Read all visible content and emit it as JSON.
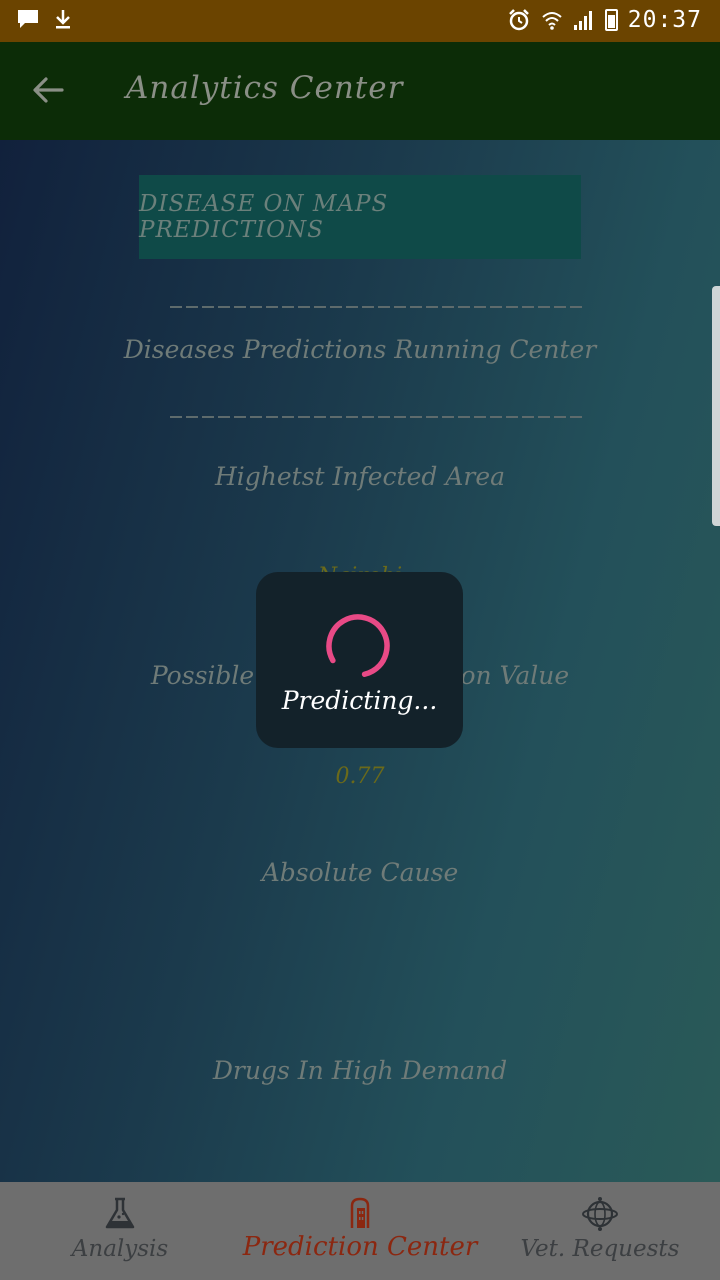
{
  "status_bar": {
    "time": "20:37",
    "icons": [
      "message-icon",
      "download-icon",
      "alarm-icon",
      "wifi-icon",
      "signal-icon",
      "battery-icon"
    ]
  },
  "app_bar": {
    "title": "Analytics Center",
    "back_icon": "arrow-left-icon"
  },
  "content": {
    "maps_button_label": "DISEASE ON MAPS PREDICTIONS",
    "running_center_label": "Diseases Predictions Running Center",
    "highest_area_label": "Highetst Infected Area",
    "highest_area_value": "Nairobi",
    "spread_label": "Possible Spread Prediction Value",
    "spread_value": "0.77",
    "cause_label": "Absolute Cause",
    "drugs_label": "Drugs In High Demand"
  },
  "dialog": {
    "message": "Predicting...",
    "spinner_color": "#e84a86"
  },
  "bottom_nav": {
    "items": [
      {
        "label": "Analysis",
        "icon": "flask-icon",
        "active": false
      },
      {
        "label": "Prediction Center",
        "icon": "building-icon",
        "active": true
      },
      {
        "label": "Vet. Requests",
        "icon": "globe-icon",
        "active": false
      }
    ]
  },
  "colors": {
    "status_bar": "#6b4400",
    "app_bar": "#0c2c07",
    "active_nav": "#8b2710"
  }
}
